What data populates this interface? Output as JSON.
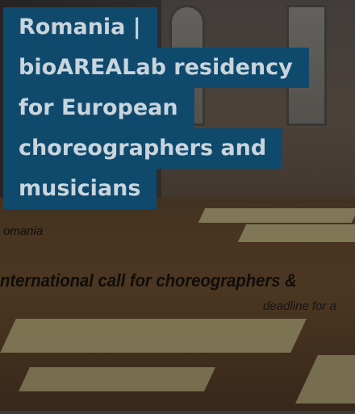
{
  "card": {
    "title_lines": [
      "Romania |",
      "bioAREALab residency",
      "for European",
      "choreographers and",
      "musicians"
    ],
    "image_text": {
      "country": "omania",
      "call": "nternational call for choreographers &",
      "deadline": "deadline for a"
    }
  },
  "colors": {
    "title_background": "#0f4a6d",
    "title_text": "#c9d4dc"
  }
}
